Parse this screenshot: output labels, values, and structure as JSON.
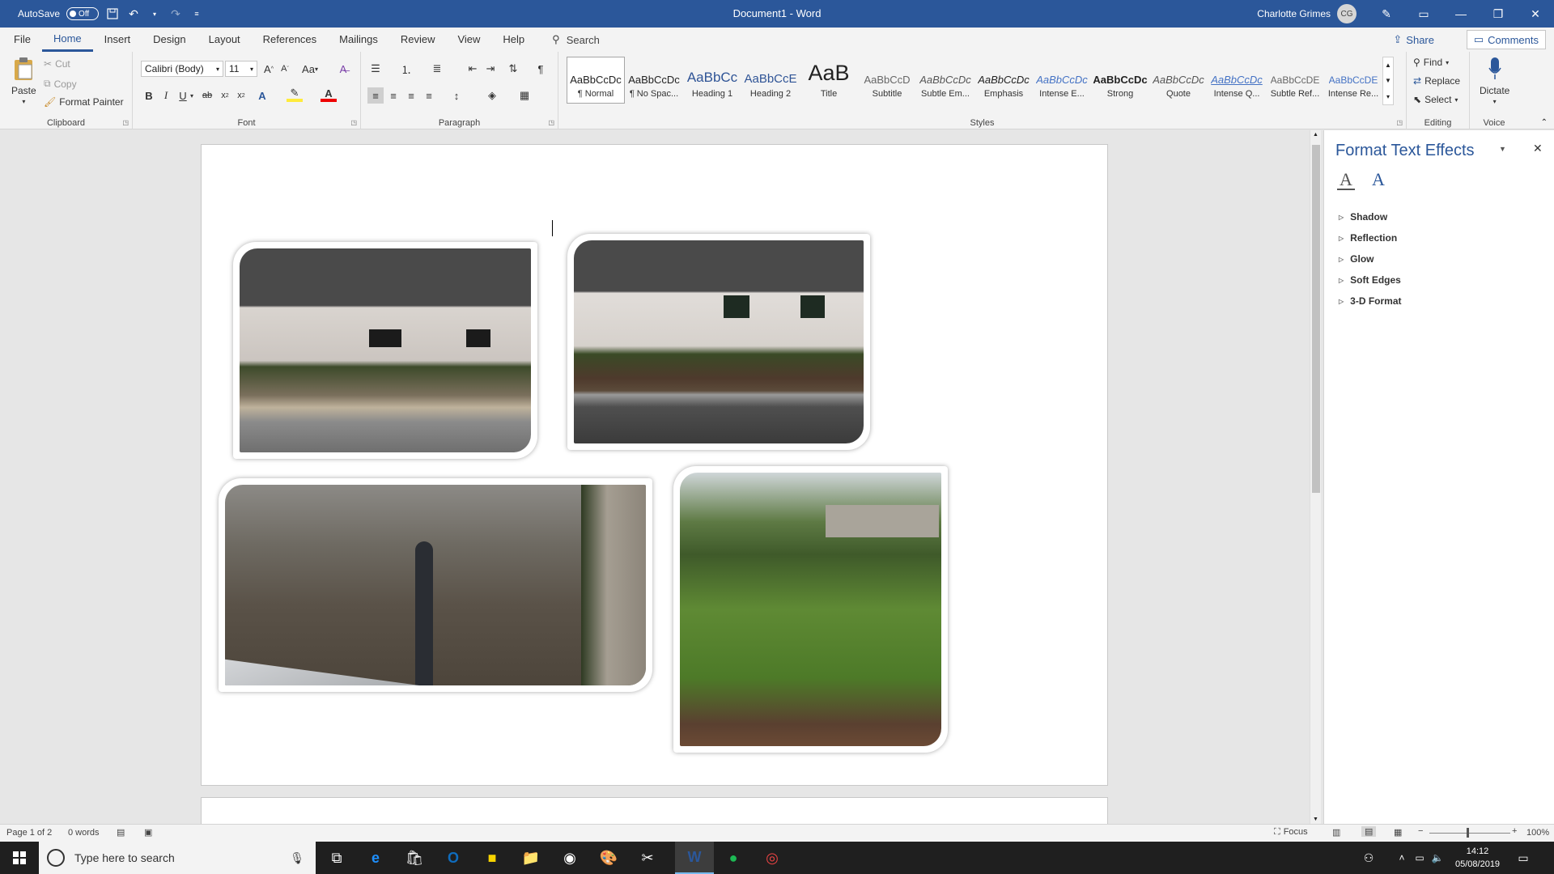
{
  "titlebar": {
    "autosave_label": "AutoSave",
    "autosave_state": "Off",
    "doc_title": "Document1 - Word",
    "user_name": "Charlotte Grimes",
    "user_initials": "CG"
  },
  "menu": {
    "tabs": [
      "File",
      "Home",
      "Insert",
      "Design",
      "Layout",
      "References",
      "Mailings",
      "Review",
      "View",
      "Help"
    ],
    "active_tab": "Home",
    "search_label": "Search",
    "share_label": "Share",
    "comments_label": "Comments"
  },
  "ribbon": {
    "clipboard": {
      "paste": "Paste",
      "cut": "Cut",
      "copy": "Copy",
      "format_painter": "Format Painter",
      "label": "Clipboard"
    },
    "font": {
      "font_name": "Calibri (Body)",
      "font_size": "11",
      "case_label": "Aa",
      "label": "Font"
    },
    "paragraph": {
      "label": "Paragraph"
    },
    "styles": {
      "label": "Styles",
      "items": [
        {
          "preview": "AaBbCcDc",
          "name": "¶ Normal"
        },
        {
          "preview": "AaBbCcDc",
          "name": "¶ No Spac..."
        },
        {
          "preview": "AaBbCc",
          "name": "Heading 1"
        },
        {
          "preview": "AaBbCcE",
          "name": "Heading 2"
        },
        {
          "preview": "AaB",
          "name": "Title"
        },
        {
          "preview": "AaBbCcD",
          "name": "Subtitle"
        },
        {
          "preview": "AaBbCcDc",
          "name": "Subtle Em..."
        },
        {
          "preview": "AaBbCcDc",
          "name": "Emphasis"
        },
        {
          "preview": "AaBbCcDc",
          "name": "Intense E..."
        },
        {
          "preview": "AaBbCcDc",
          "name": "Strong"
        },
        {
          "preview": "AaBbCcDc",
          "name": "Quote"
        },
        {
          "preview": "AaBbCcDc",
          "name": "Intense Q..."
        },
        {
          "preview": "AaBbCcDE",
          "name": "Subtle Ref..."
        },
        {
          "preview": "AaBbCcDE",
          "name": "Intense Re..."
        }
      ]
    },
    "editing": {
      "find": "Find",
      "replace": "Replace",
      "select": "Select",
      "label": "Editing"
    },
    "voice": {
      "dictate": "Dictate",
      "label": "Voice"
    }
  },
  "pane": {
    "title": "Format Text Effects",
    "sections": [
      "Shadow",
      "Reflection",
      "Glow",
      "Soft Edges",
      "3-D Format"
    ]
  },
  "status": {
    "page": "Page 1 of 2",
    "words": "0 words",
    "focus": "Focus",
    "zoom": "100%"
  },
  "taskbar": {
    "search_placeholder": "Type here to search",
    "time": "14:12",
    "date": "05/08/2019"
  },
  "colors": {
    "brand": "#2b579a",
    "taskbar": "#1f1f1f"
  }
}
